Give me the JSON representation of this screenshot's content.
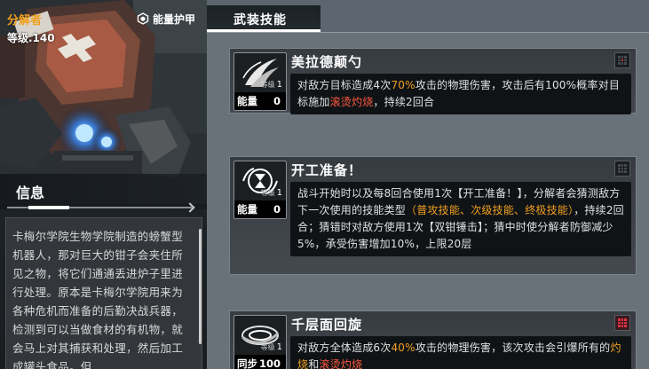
{
  "unit": {
    "name": "分解者",
    "level": "等级.140"
  },
  "tabs": {
    "energy_armor": "能量护甲",
    "weapon_skills": "武装技能"
  },
  "info": {
    "title": "信息",
    "text": "卡梅尔学院生物学院制造的螃蟹型机器人，那对巨大的钳子会夹住所见之物，将它们通通丢进炉子里进行处理。原本是卡梅尔学院用来为各种危机而准备的后勤决战兵器，检测到可以当做食材的有机物，就会马上对其捕获和处理，然后加工成罐头食品。但"
  },
  "skills": [
    {
      "name": "美拉德颠勺",
      "level_label": "等级",
      "level": "1",
      "cost_label": "能量",
      "cost": "0",
      "desc_parts": [
        {
          "t": "对敌方目标造成4次",
          "c": ""
        },
        {
          "t": "70%",
          "c": "orange"
        },
        {
          "t": "攻击的物理伤害，攻击后有100%概率对目标施加",
          "c": ""
        },
        {
          "t": "滚烫灼烧",
          "c": "red"
        },
        {
          "t": "，持续2回合",
          "c": ""
        }
      ],
      "grid_icon": "grid-center-red-icon"
    },
    {
      "name": "开工准备！",
      "level_label": "等级",
      "level": "1",
      "cost_label": "能量",
      "cost": "0",
      "desc_parts": [
        {
          "t": "战斗开始时以及每8回合使用1次【开工准备！】，分解者会猜测敌方下一次使用的技能类型",
          "c": ""
        },
        {
          "t": "（普攻技能、次级技能、终极技能）",
          "c": "orange"
        },
        {
          "t": "，持续2回合；猜错时对敌方使用1次【双钳锤击】；猜中时使分解者防御减少5%，承受伤害增加10%，上限20层",
          "c": ""
        }
      ],
      "grid_icon": "grid-empty-icon"
    },
    {
      "name": "千层面回旋",
      "level_label": "等级",
      "level": "1",
      "cost_label": "同步",
      "cost": "100",
      "desc_parts": [
        {
          "t": "对敌方全体造成6次",
          "c": ""
        },
        {
          "t": "40%",
          "c": "orange"
        },
        {
          "t": "攻击的物理伤害，该次攻击会引爆所有的",
          "c": ""
        },
        {
          "t": "灼烧",
          "c": "orange"
        },
        {
          "t": "和",
          "c": ""
        },
        {
          "t": "滚烫灼烧",
          "c": "red"
        }
      ],
      "grid_icon": "grid-all-red-icon"
    }
  ]
}
